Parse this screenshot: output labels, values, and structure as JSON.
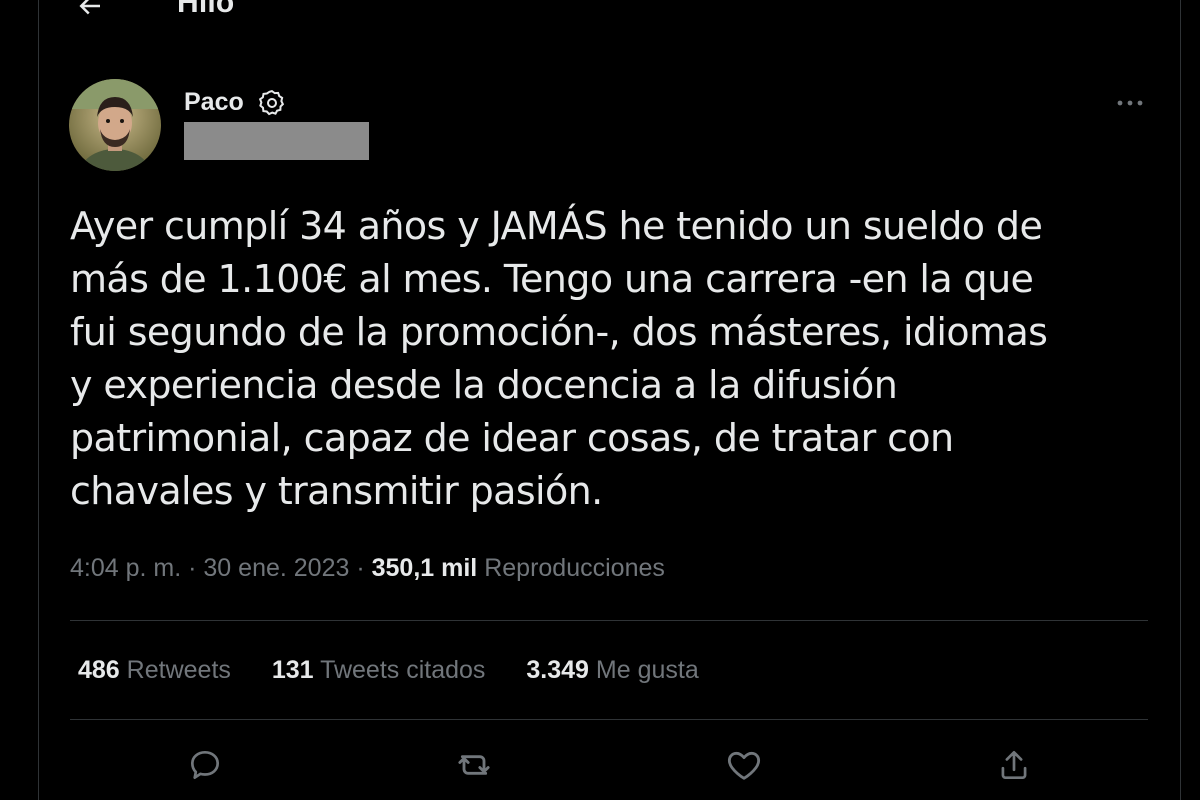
{
  "header": {
    "title": "Hilo",
    "back_icon": "arrow-left-icon"
  },
  "author": {
    "name": "Paco",
    "badge_icon": "verified-badge-icon"
  },
  "tweet": {
    "text": "Ayer cumplí 34 años y JAMÁS he tenido un sueldo de\nmás de 1.100€ al mes. Tengo una carrera -en la que\nfui segundo de la promoción-, dos másteres, idiomas\ny experiencia desde la docencia a la difusión\npatrimonial, capaz de idear cosas, de tratar con\nchavales y transmitir pasión.",
    "time": "4:04 p. m.",
    "sep": "·",
    "date": "30 ene. 2023",
    "views_count": "350,1 mil",
    "views_label": "Reproducciones"
  },
  "stats": [
    {
      "count": "486",
      "label": "Retweets"
    },
    {
      "count": "131",
      "label": "Tweets citados"
    },
    {
      "count": "3.349",
      "label": "Me gusta"
    }
  ],
  "actions": [
    {
      "icon": "reply-icon"
    },
    {
      "icon": "retweet-icon"
    },
    {
      "icon": "like-heart-icon"
    },
    {
      "icon": "share-icon"
    }
  ],
  "colors": {
    "background": "#000000",
    "text": "#e7e9ea",
    "secondary": "#71767b",
    "divider": "#2f3336"
  }
}
